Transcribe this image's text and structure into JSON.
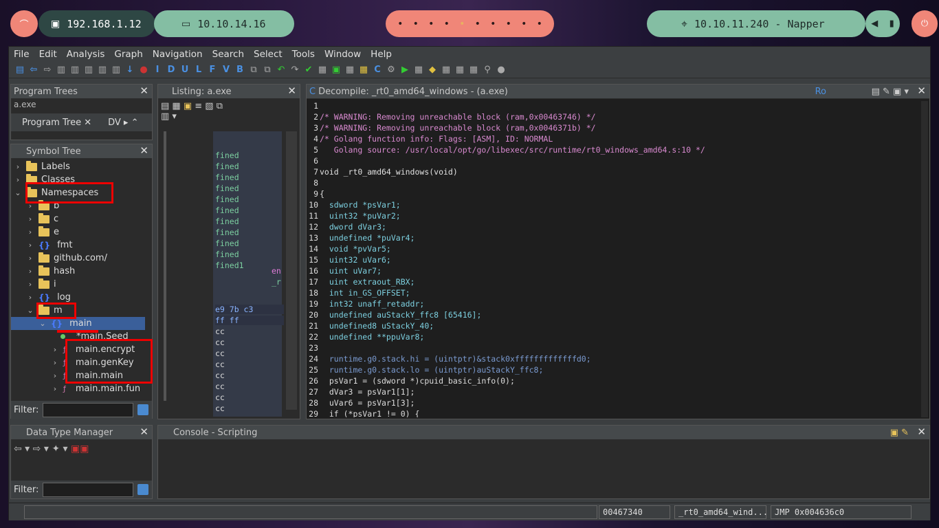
{
  "topbar": {
    "ip1": "192.168.1.12",
    "ip2": "10.10.14.16",
    "target": "10.10.11.240 - Napper",
    "workspace_count": 10,
    "active_workspace": 5
  },
  "menu": [
    "File",
    "Edit",
    "Analysis",
    "Graph",
    "Navigation",
    "Search",
    "Select",
    "Tools",
    "Window",
    "Help"
  ],
  "program_trees": {
    "title": "Program Trees",
    "tab1": "Program Tree",
    "tab2": "DV",
    "stub": "a.exe"
  },
  "symbol_tree": {
    "title": "Symbol Tree",
    "items": [
      {
        "label": "Labels",
        "depth": 0,
        "icon": "folder-icon",
        "chev": "›"
      },
      {
        "label": "Classes",
        "depth": 0,
        "icon": "folder-icon",
        "chev": "›"
      },
      {
        "label": "Namespaces",
        "depth": 0,
        "icon": "folder-icon",
        "chev": "⌄"
      },
      {
        "label": "b",
        "depth": 1,
        "icon": "folder-icon",
        "chev": "›"
      },
      {
        "label": "c",
        "depth": 1,
        "icon": "folder-icon",
        "chev": "›"
      },
      {
        "label": "e",
        "depth": 1,
        "icon": "folder-icon",
        "chev": "›"
      },
      {
        "label": "fmt",
        "depth": 1,
        "icon": "namespace-icon",
        "chev": "›"
      },
      {
        "label": "github.com/",
        "depth": 1,
        "icon": "folder-icon",
        "chev": "›"
      },
      {
        "label": "hash",
        "depth": 1,
        "icon": "folder-icon",
        "chev": "›"
      },
      {
        "label": "i",
        "depth": 1,
        "icon": "folder-icon",
        "chev": "›"
      },
      {
        "label": "log",
        "depth": 1,
        "icon": "namespace-icon",
        "chev": "›"
      },
      {
        "label": "m",
        "depth": 1,
        "icon": "folder-icon",
        "chev": "⌄"
      },
      {
        "label": "main",
        "depth": 2,
        "icon": "namespace-icon",
        "chev": "⌄"
      },
      {
        "label": "*main.Seed",
        "depth": 3,
        "icon": "dot-icon",
        "chev": ""
      },
      {
        "label": "main.encrypt",
        "depth": 3,
        "icon": "function-icon",
        "chev": "›"
      },
      {
        "label": "main.genKey",
        "depth": 3,
        "icon": "function-icon",
        "chev": "›"
      },
      {
        "label": "main.main",
        "depth": 3,
        "icon": "function-icon",
        "chev": "›"
      },
      {
        "label": "main.main.fun",
        "depth": 3,
        "icon": "function-icon",
        "chev": "›"
      }
    ],
    "filter_label": "Filter:"
  },
  "data_type_manager": {
    "title": "Data Type Manager",
    "filter_label": "Filter:"
  },
  "listing": {
    "title": "Listing:  a.exe",
    "lines": [
      "fined",
      "fined",
      "fined",
      "fined",
      "fined",
      "fined",
      "fined",
      "fined",
      "fined",
      "fined",
      "fined1"
    ],
    "bytes1": "e9 7b c3",
    "bytes2": "ff ff",
    "cc": [
      "cc",
      "cc",
      "cc",
      "cc",
      "cc",
      "cc",
      "cc",
      "cc",
      "cc",
      "cc"
    ],
    "side1": "en",
    "side2": "_r"
  },
  "decompile": {
    "title": "Decompile: _rt0_amd64_windows -  (a.exe)",
    "ro": "Ro",
    "lines": [
      {
        "n": "1",
        "t": ""
      },
      {
        "n": "2",
        "t": "/* WARNING: Removing unreachable block (ram,0x00463746) */"
      },
      {
        "n": "3",
        "t": "/* WARNING: Removing unreachable block (ram,0x0046371b) */"
      },
      {
        "n": "4",
        "t": "/* Golang function info: Flags: [ASM], ID: NORMAL"
      },
      {
        "n": "5",
        "t": "   Golang source: /usr/local/opt/go/libexec/src/runtime/rt0_windows_amd64.s:10 */"
      },
      {
        "n": "6",
        "t": ""
      },
      {
        "n": "7",
        "t": "void _rt0_amd64_windows(void)"
      },
      {
        "n": "8",
        "t": ""
      },
      {
        "n": "9",
        "t": "{"
      },
      {
        "n": "10",
        "t": "  sdword *psVar1;"
      },
      {
        "n": "11",
        "t": "  uint32 *puVar2;"
      },
      {
        "n": "12",
        "t": "  dword dVar3;"
      },
      {
        "n": "13",
        "t": "  undefined *puVar4;"
      },
      {
        "n": "14",
        "t": "  void *pvVar5;"
      },
      {
        "n": "15",
        "t": "  uint32 uVar6;"
      },
      {
        "n": "16",
        "t": "  uint uVar7;"
      },
      {
        "n": "17",
        "t": "  uint extraout_RBX;"
      },
      {
        "n": "18",
        "t": "  int in_GS_OFFSET;"
      },
      {
        "n": "19",
        "t": "  int32 unaff_retaddr;"
      },
      {
        "n": "20",
        "t": "  undefined auStackY_ffc8 [65416];"
      },
      {
        "n": "21",
        "t": "  undefined8 uStackY_40;"
      },
      {
        "n": "22",
        "t": "  undefined **ppuVar8;"
      },
      {
        "n": "23",
        "t": ""
      },
      {
        "n": "24",
        "t": "  runtime.g0.stack.hi = (uintptr)&stack0xfffffffffffffd0;"
      },
      {
        "n": "25",
        "t": "  runtime.g0.stack.lo = (uintptr)auStackY_ffc8;"
      },
      {
        "n": "26",
        "t": "  psVar1 = (sdword *)cpuid_basic_info(0);"
      },
      {
        "n": "27",
        "t": "  dVar3 = psVar1[1];"
      },
      {
        "n": "28",
        "t": "  uVar6 = psVar1[3];"
      },
      {
        "n": "29",
        "t": "  if (*psVar1 != 0) {"
      }
    ]
  },
  "console": {
    "title": "Console - Scripting"
  },
  "status": {
    "address": "00467340",
    "function": "_rt0_amd64_wind...",
    "instruction": "JMP 0x004636c0"
  }
}
